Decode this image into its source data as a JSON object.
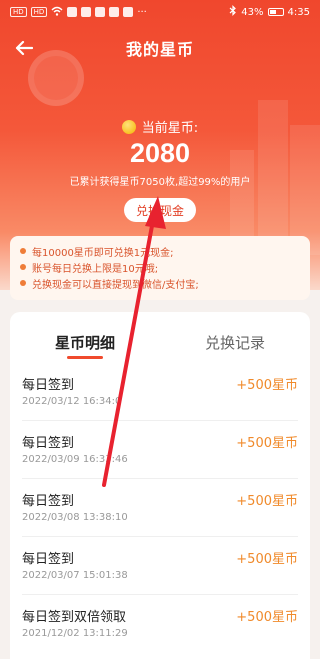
{
  "status_bar": {
    "network_chips": [
      "HD",
      "HD"
    ],
    "battery": "43%",
    "time": "4:35"
  },
  "header": {
    "back_icon": "back-arrow-icon",
    "title": "我的星币"
  },
  "summary": {
    "label": "当前星币:",
    "amount": "2080",
    "sub_text": "已累计获得星币7050枚,超过99%的用户",
    "exchange_button": "兑换现金"
  },
  "rules": [
    "每10000星币即可兑换1元现金;",
    "账号每日兑换上限是10元哦;",
    "兑换现金可以直接提现到微信/支付宝;"
  ],
  "tabs": [
    {
      "label": "星币明细",
      "active": true
    },
    {
      "label": "兑换记录",
      "active": false
    }
  ],
  "records": [
    {
      "title": "每日签到",
      "date": "2022/03/12 16:34:0",
      "amount": "+500星币"
    },
    {
      "title": "每日签到",
      "date": "2022/03/09 16:33:46",
      "amount": "+500星币"
    },
    {
      "title": "每日签到",
      "date": "2022/03/08 13:38:10",
      "amount": "+500星币"
    },
    {
      "title": "每日签到",
      "date": "2022/03/07 15:01:38",
      "amount": "+500星币"
    },
    {
      "title": "每日签到双倍领取",
      "date": "2021/12/02 13:11:29",
      "amount": "+500星币"
    }
  ],
  "colors": {
    "accent": "#f04a2d",
    "amount": "#f08a2b",
    "annotation_arrow": "#e8222f"
  }
}
